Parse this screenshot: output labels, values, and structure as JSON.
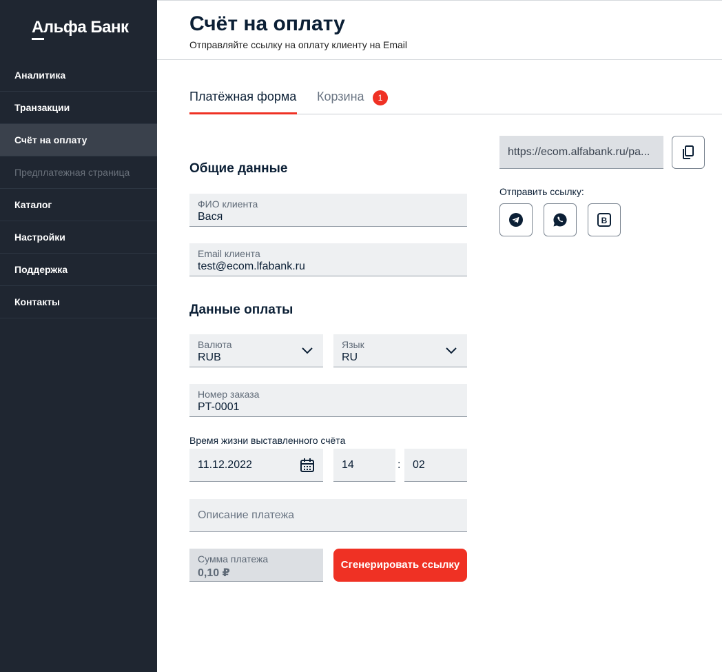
{
  "sidebar": {
    "logo": "Альфа Банк",
    "items": [
      {
        "label": "Аналитика"
      },
      {
        "label": "Транзакции"
      },
      {
        "label": "Счёт на оплату"
      },
      {
        "label": "Предплатежная страница"
      },
      {
        "label": "Каталог"
      },
      {
        "label": "Настройки"
      },
      {
        "label": "Поддержка"
      },
      {
        "label": "Контакты"
      }
    ],
    "active_item": "Счёт на оплату",
    "disabled_item": "Предплатежная страница"
  },
  "header": {
    "title": "Счёт на оплату",
    "subtitle": "Отправляйте ссылку на оплату клиенту на Email"
  },
  "tabs": {
    "form": "Платёжная форма",
    "cart": "Корзина",
    "cart_badge": "1"
  },
  "general": {
    "title": "Общие данные",
    "name_label": "ФИО клиента",
    "name_value": "Вася",
    "email_label": "Email клиента",
    "email_value": "test@ecom.lfabank.ru"
  },
  "payment": {
    "title": "Данные оплаты",
    "currency_label": "Валюта",
    "currency_value": "RUB",
    "language_label": "Язык",
    "language_value": "RU",
    "order_label": "Номер заказа",
    "order_value": "PT-0001",
    "lifetime_label": "Время жизни выставленного счёта",
    "date_value": "11.12.2022",
    "hours_value": "14",
    "time_separator": ":",
    "minutes_value": "02",
    "description_placeholder": "Описание платежа",
    "amount_label": "Сумма платежа",
    "amount_value": "0,10 ₽",
    "generate_label": "Сгенерировать ссылку"
  },
  "share": {
    "link": "https://ecom.alfabank.ru/pa...",
    "send_label": "Отправить ссылку:",
    "vk_glyph": "B"
  },
  "colors": {
    "sidebar_bg": "#1f2631",
    "accent": "#ef3124",
    "field_bg": "#eef0f2"
  }
}
